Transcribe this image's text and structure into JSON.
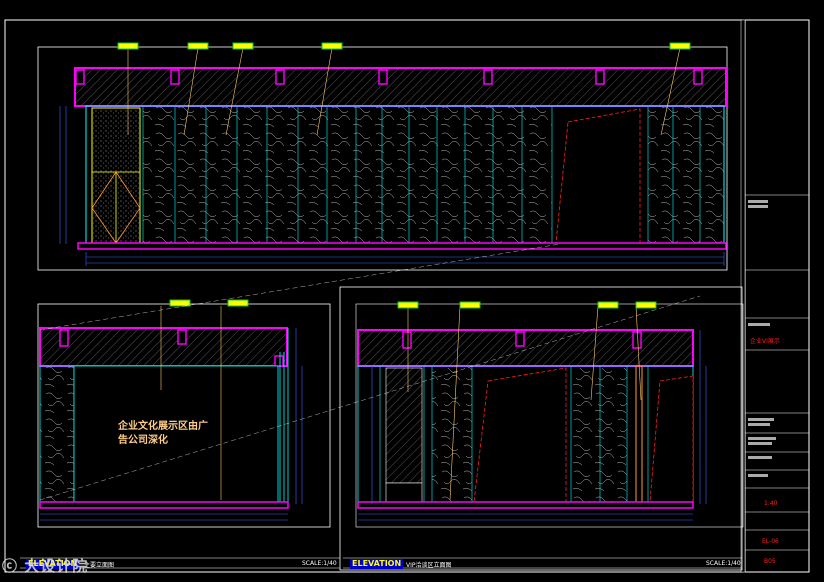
{
  "annotation": {
    "text": "企业文化展示区由广告公司深化"
  },
  "watermark": {
    "text": "ⓒ 大设计院"
  },
  "views": {
    "left": {
      "elevation_label": "ELEVATION",
      "view_name": "主要立面图",
      "scale": "SCALE:1/40"
    },
    "right": {
      "elevation_label": "ELEVATION",
      "view_name": "VIP洽谈区立面图",
      "scale": "SCALE:1/40"
    }
  },
  "title_block": {
    "red_title": "企业VI展示",
    "sheet_no": "EL-06",
    "scale": "1:40",
    "page": "B05"
  },
  "colors": {
    "magenta": "#ff00ff",
    "cyan": "#00ffff",
    "yellow": "#ffff00",
    "white": "#ffffff",
    "red": "#ff2020",
    "orange": "#ff9933",
    "green": "#00cc33",
    "dim_blue": "#3366ff"
  },
  "icons": {
    "watermark": "copyright-icon",
    "tag": "material-tag-icon"
  }
}
